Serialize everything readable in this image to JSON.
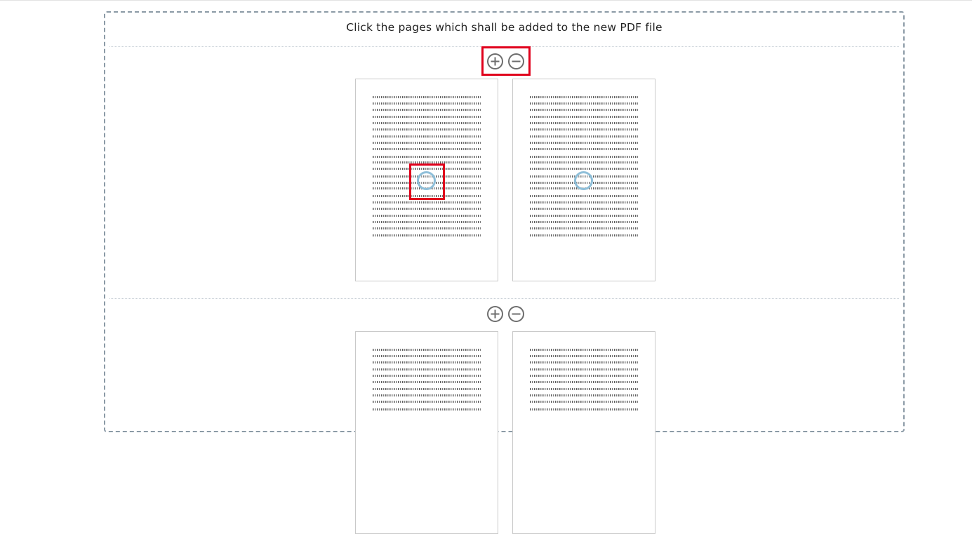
{
  "instruction_text": "Click the pages which shall be added to the new PDF file",
  "zoom_controls": {
    "zoom_in_icon": "plus-circle-icon",
    "zoom_out_icon": "minus-circle-icon"
  },
  "highlight_color": "#e0001b",
  "spinner_color": "#8fbfd9",
  "documents": [
    {
      "pages": [
        {
          "loading": true
        },
        {
          "loading": true
        }
      ]
    },
    {
      "pages": [
        {
          "loading": false
        },
        {
          "loading": false
        }
      ]
    }
  ]
}
